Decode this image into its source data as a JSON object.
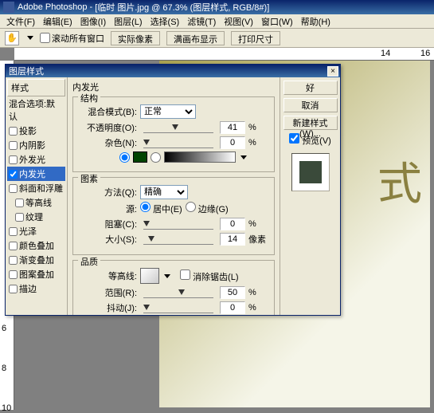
{
  "titlebar": {
    "app": "Adobe Photoshop",
    "doc": "[临时 图片.jpg @ 67.3% (图层样式, RGB/8#)]"
  },
  "menu": [
    "文件(F)",
    "编辑(E)",
    "图像(I)",
    "图层(L)",
    "选择(S)",
    "滤镜(T)",
    "视图(V)",
    "窗口(W)",
    "帮助(H)"
  ],
  "toolbar": {
    "scroll_all": "滚动所有窗口",
    "btn1": "实际像素",
    "btn2": "满画布显示",
    "btn3": "打印尺寸"
  },
  "ruler_h": [
    "14",
    "16"
  ],
  "ruler_v": [
    "6",
    "8",
    "10"
  ],
  "doc_text": "式",
  "dialog": {
    "title": "图层样式",
    "sidebar": {
      "header": "样式",
      "blend_defaults": "混合选项:默认",
      "items": [
        {
          "label": "投影",
          "checked": false
        },
        {
          "label": "内阴影",
          "checked": false
        },
        {
          "label": "外发光",
          "checked": false
        },
        {
          "label": "内发光",
          "checked": true,
          "selected": true
        },
        {
          "label": "斜面和浮雕",
          "checked": false
        },
        {
          "label": "等高线",
          "checked": false,
          "sub": true
        },
        {
          "label": "纹理",
          "checked": false,
          "sub": true
        },
        {
          "label": "光泽",
          "checked": false
        },
        {
          "label": "颜色叠加",
          "checked": false
        },
        {
          "label": "渐变叠加",
          "checked": false
        },
        {
          "label": "图案叠加",
          "checked": false
        },
        {
          "label": "描边",
          "checked": false
        }
      ]
    },
    "panel_title": "内发光",
    "structure": {
      "title": "结构",
      "blend_mode_label": "混合模式(B):",
      "blend_mode": "正常",
      "opacity_label": "不透明度(O):",
      "opacity": "41",
      "noise_label": "杂色(N):",
      "noise": "0",
      "pct": "%",
      "color": "#004400"
    },
    "elements": {
      "title": "图素",
      "technique_label": "方法(Q):",
      "technique": "精确",
      "source_label": "源:",
      "source_center": "居中(E)",
      "source_edge": "边缘(G)",
      "choke_label": "阻塞(C):",
      "choke": "0",
      "size_label": "大小(S):",
      "size": "14",
      "pct": "%",
      "px": "像素"
    },
    "quality": {
      "title": "品质",
      "contour_label": "等高线:",
      "antialias": "消除锯齿(L)",
      "range_label": "范围(R):",
      "range": "50",
      "jitter_label": "抖动(J):",
      "jitter": "0",
      "pct": "%"
    },
    "buttons": {
      "ok": "好",
      "cancel": "取消",
      "new_style": "新建样式(W)...",
      "preview": "预览(V)"
    }
  }
}
